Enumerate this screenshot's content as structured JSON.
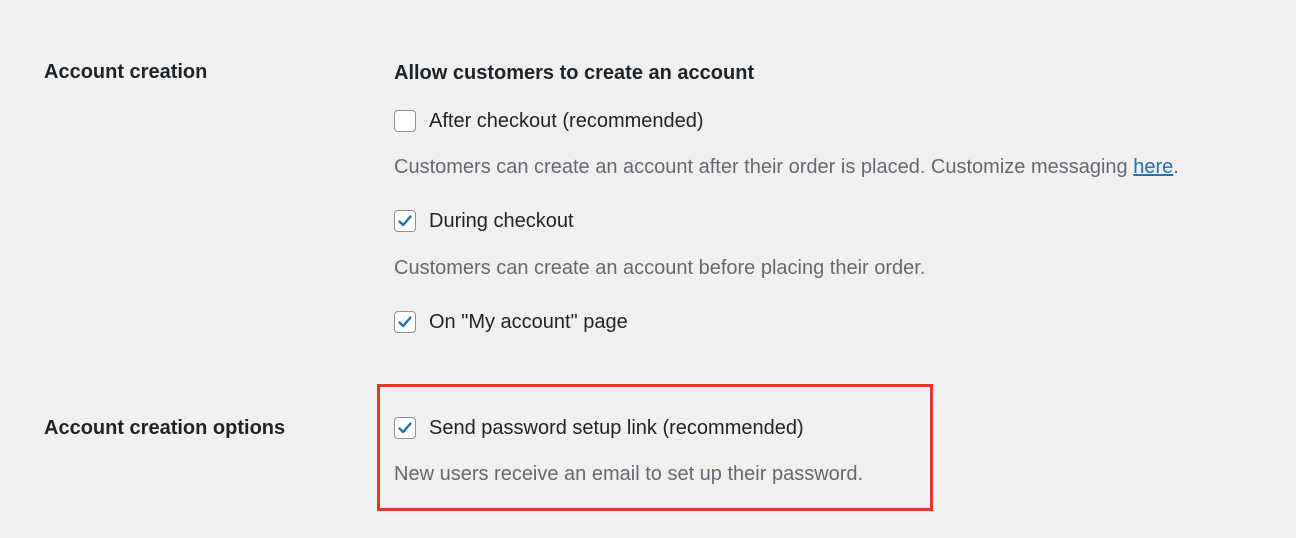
{
  "account_creation": {
    "label": "Account creation",
    "title": "Allow customers to create an account",
    "options": [
      {
        "label": "After checkout (recommended)",
        "checked": false,
        "description_prefix": "Customers can create an account after their order is placed. Customize messaging ",
        "description_link": "here",
        "description_suffix": "."
      },
      {
        "label": "During checkout",
        "checked": true,
        "description": "Customers can create an account before placing their order."
      },
      {
        "label": "On \"My account\" page",
        "checked": true
      }
    ]
  },
  "account_creation_options": {
    "label": "Account creation options",
    "option": {
      "label": "Send password setup link (recommended)",
      "checked": true,
      "description": "New users receive an email to set up their password."
    }
  },
  "colors": {
    "background": "#f0f0f1",
    "text": "#1d2327",
    "description": "#646970",
    "link": "#2271b1",
    "checkmark": "#2271b1",
    "highlight": "#e0392b"
  },
  "icons": {
    "checkbox_checked": "checkmark-icon"
  }
}
